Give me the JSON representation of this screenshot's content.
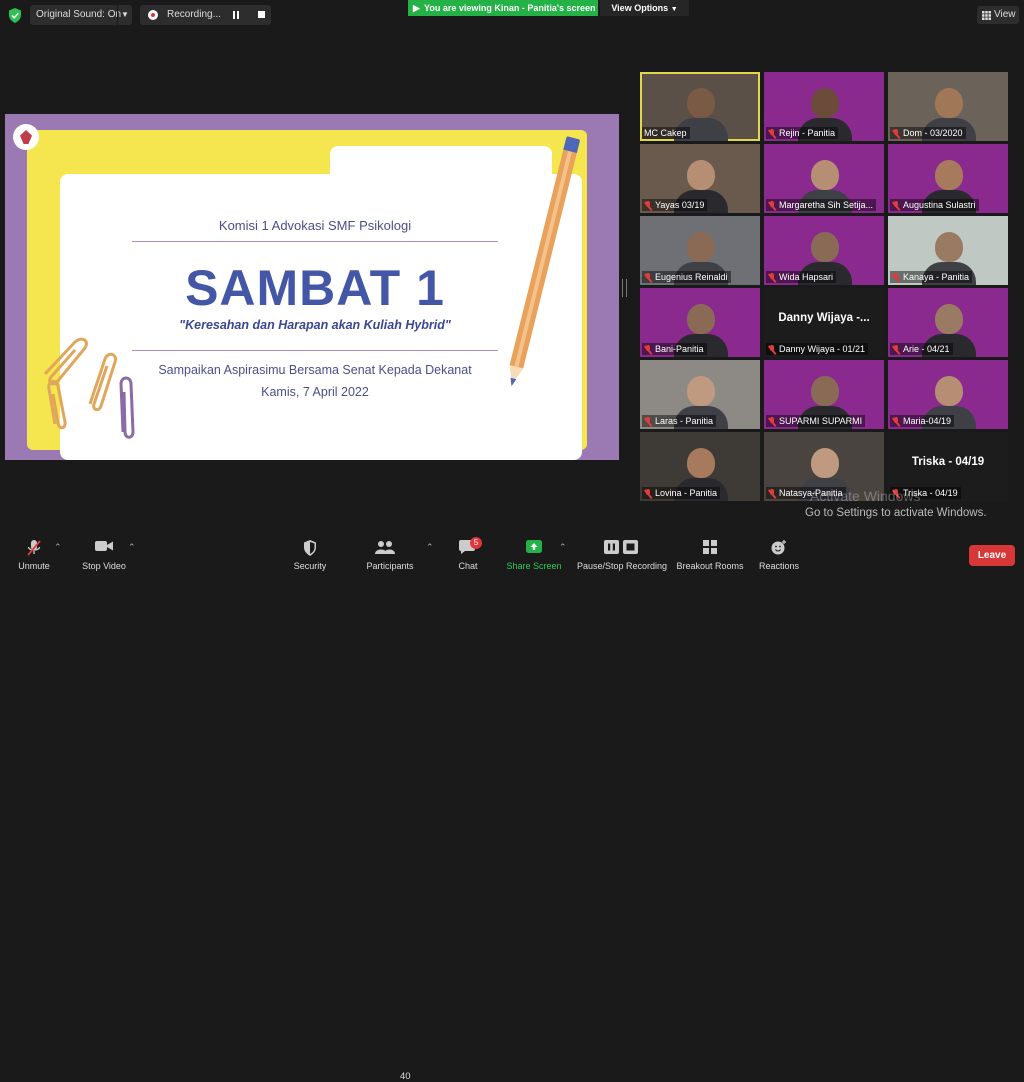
{
  "top": {
    "audio_label": "Original Sound: On",
    "recording_label": "Recording...",
    "viewing_banner": "You are viewing Kinan - Panitia's screen",
    "view_options": "View Options",
    "view_button": "View"
  },
  "slide": {
    "commission": "Komisi 1 Advokasi SMF Psikologi",
    "title": "SAMBAT 1",
    "subtitle": "\"Keresahan dan Harapan akan Kuliah Hybrid\"",
    "invite": "Sampaikan Aspirasimu Bersama Senat Kepada Dekanat",
    "date": "Kamis, 7 April 2022"
  },
  "participants": [
    {
      "name": "MC Cakep",
      "muted": false
    },
    {
      "name": "Rejin - Panitia",
      "muted": true
    },
    {
      "name": "Dom - 03/2020",
      "muted": true
    },
    {
      "name": "Yayas 03/19",
      "muted": true
    },
    {
      "name": "Margaretha Sih Setija...",
      "muted": true
    },
    {
      "name": "Augustina Sulastri",
      "muted": true
    },
    {
      "name": "Eugenius Reinaldi",
      "muted": true
    },
    {
      "name": "Wida Hapsari",
      "muted": true
    },
    {
      "name": "Kanaya - Panitia",
      "muted": true
    },
    {
      "name": "Bani-Panitia",
      "muted": true
    },
    {
      "name": "Danny Wijaya - 01/21",
      "muted": true,
      "big_name": "Danny Wijaya -..."
    },
    {
      "name": "Arie - 04/21",
      "muted": true
    },
    {
      "name": "Laras - Panitia",
      "muted": true
    },
    {
      "name": "SUPARMI SUPARMI",
      "muted": true
    },
    {
      "name": "Maria-04/19",
      "muted": true
    },
    {
      "name": "Lovina - Panitia",
      "muted": true
    },
    {
      "name": "Natasya-Panitia",
      "muted": true
    },
    {
      "name": "Triska - 04/19",
      "muted": true,
      "big_name": "Triska - 04/19"
    }
  ],
  "watermark": {
    "line1": "Activate Windows",
    "line2": "Go to Settings to activate Windows."
  },
  "toolbar": {
    "unmute": "Unmute",
    "stop_video": "Stop Video",
    "security": "Security",
    "participants": "Participants",
    "participant_count": "40",
    "chat": "Chat",
    "chat_badge": "5",
    "share_screen": "Share Screen",
    "pause_stop_recording": "Pause/Stop Recording",
    "breakout_rooms": "Breakout Rooms",
    "reactions": "Reactions",
    "leave": "Leave"
  },
  "colors": {
    "share_green": "#24b247",
    "leave_red": "#d83737",
    "slide_purple": "#9b7ab3",
    "slide_title": "#4456a6"
  }
}
